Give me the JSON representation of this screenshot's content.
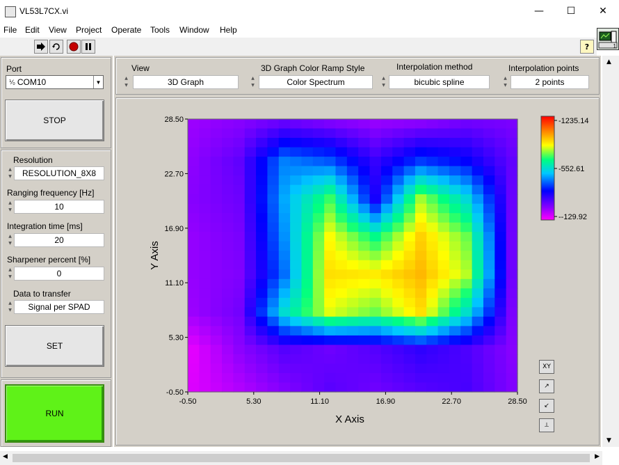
{
  "window": {
    "title": "VL53L7CX.vi",
    "minimize_glyph": "—",
    "maximize_glyph": "☐",
    "close_glyph": "✕"
  },
  "menu": [
    "File",
    "Edit",
    "View",
    "Project",
    "Operate",
    "Tools",
    "Window",
    "Help"
  ],
  "toolbar": {
    "run_icon": "run-arrow-icon",
    "run_continuous_icon": "run-continuously-icon",
    "abort_icon": "abort-icon",
    "pause_icon": "pause-icon",
    "help_label": "?"
  },
  "vi_icon_badge": "1",
  "left": {
    "port_label": "Port",
    "port_value": "COM10",
    "stop_label": "STOP",
    "resolution_label": "Resolution",
    "resolution_value": "RESOLUTION_8X8",
    "ranging_label": "Ranging frequency [Hz]",
    "ranging_value": "10",
    "integration_label": "Integration time [ms]",
    "integration_value": "20",
    "sharpener_label": "Sharpener percent [%]",
    "sharpener_value": "0",
    "transfer_label": "Data to transfer",
    "transfer_value": "Signal per SPAD",
    "set_label": "SET",
    "run_label": "RUN"
  },
  "top_controls": {
    "view_label": "View",
    "view_value": "3D Graph",
    "ramp_label": "3D Graph Color Ramp Style",
    "ramp_value": "Color Spectrum",
    "interp_label": "Interpolation method",
    "interp_value": "bicubic spline",
    "points_label": "Interpolation points",
    "points_value": "2 points"
  },
  "chart_data": {
    "type": "heatmap",
    "xlabel": "X Axis",
    "ylabel": "Y Axis",
    "xlim": [
      -0.5,
      28.5
    ],
    "ylim": [
      -0.5,
      28.5
    ],
    "xticks": [
      "-0.50",
      "5.30",
      "11.10",
      "16.90",
      "22.70",
      "28.50"
    ],
    "yticks": [
      "28.50",
      "22.70",
      "16.90",
      "11.10",
      "5.30",
      "-0.50"
    ],
    "colorbar": {
      "max": "1235.14",
      "mid": "552.61",
      "min": "-129.92"
    },
    "grid_size": 8,
    "values": [
      [
        10,
        40,
        100,
        60,
        20,
        40,
        80,
        60
      ],
      [
        30,
        100,
        400,
        350,
        170,
        320,
        250,
        100
      ],
      [
        40,
        80,
        450,
        700,
        220,
        780,
        540,
        90
      ],
      [
        20,
        60,
        420,
        850,
        650,
        920,
        740,
        80
      ],
      [
        20,
        50,
        380,
        900,
        880,
        960,
        800,
        80
      ],
      [
        10,
        70,
        550,
        830,
        740,
        900,
        560,
        60
      ],
      [
        -90,
        30,
        120,
        80,
        120,
        180,
        130,
        40
      ],
      [
        -80,
        -20,
        50,
        110,
        80,
        120,
        140,
        50
      ]
    ],
    "grid": false
  }
}
